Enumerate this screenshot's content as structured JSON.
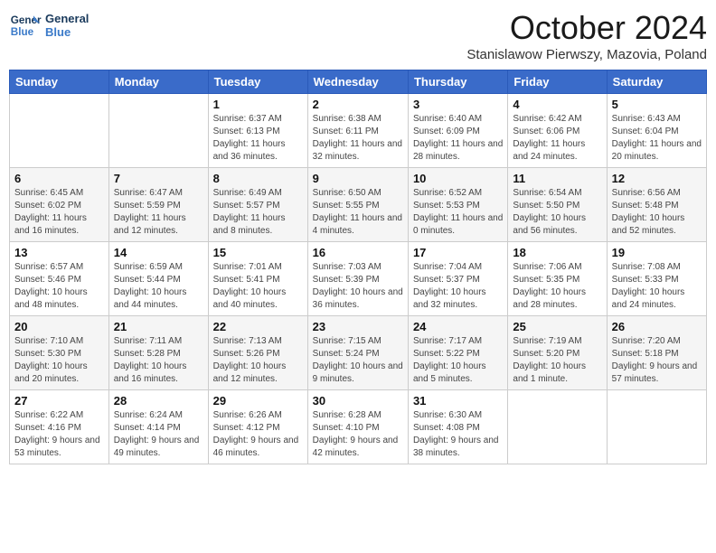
{
  "header": {
    "logo_line1": "General",
    "logo_line2": "Blue",
    "title": "October 2024",
    "subtitle": "Stanislawow Pierwszy, Mazovia, Poland"
  },
  "weekdays": [
    "Sunday",
    "Monday",
    "Tuesday",
    "Wednesday",
    "Thursday",
    "Friday",
    "Saturday"
  ],
  "weeks": [
    [
      {
        "day": "",
        "info": ""
      },
      {
        "day": "",
        "info": ""
      },
      {
        "day": "1",
        "info": "Sunrise: 6:37 AM\nSunset: 6:13 PM\nDaylight: 11 hours and 36 minutes."
      },
      {
        "day": "2",
        "info": "Sunrise: 6:38 AM\nSunset: 6:11 PM\nDaylight: 11 hours and 32 minutes."
      },
      {
        "day": "3",
        "info": "Sunrise: 6:40 AM\nSunset: 6:09 PM\nDaylight: 11 hours and 28 minutes."
      },
      {
        "day": "4",
        "info": "Sunrise: 6:42 AM\nSunset: 6:06 PM\nDaylight: 11 hours and 24 minutes."
      },
      {
        "day": "5",
        "info": "Sunrise: 6:43 AM\nSunset: 6:04 PM\nDaylight: 11 hours and 20 minutes."
      }
    ],
    [
      {
        "day": "6",
        "info": "Sunrise: 6:45 AM\nSunset: 6:02 PM\nDaylight: 11 hours and 16 minutes."
      },
      {
        "day": "7",
        "info": "Sunrise: 6:47 AM\nSunset: 5:59 PM\nDaylight: 11 hours and 12 minutes."
      },
      {
        "day": "8",
        "info": "Sunrise: 6:49 AM\nSunset: 5:57 PM\nDaylight: 11 hours and 8 minutes."
      },
      {
        "day": "9",
        "info": "Sunrise: 6:50 AM\nSunset: 5:55 PM\nDaylight: 11 hours and 4 minutes."
      },
      {
        "day": "10",
        "info": "Sunrise: 6:52 AM\nSunset: 5:53 PM\nDaylight: 11 hours and 0 minutes."
      },
      {
        "day": "11",
        "info": "Sunrise: 6:54 AM\nSunset: 5:50 PM\nDaylight: 10 hours and 56 minutes."
      },
      {
        "day": "12",
        "info": "Sunrise: 6:56 AM\nSunset: 5:48 PM\nDaylight: 10 hours and 52 minutes."
      }
    ],
    [
      {
        "day": "13",
        "info": "Sunrise: 6:57 AM\nSunset: 5:46 PM\nDaylight: 10 hours and 48 minutes."
      },
      {
        "day": "14",
        "info": "Sunrise: 6:59 AM\nSunset: 5:44 PM\nDaylight: 10 hours and 44 minutes."
      },
      {
        "day": "15",
        "info": "Sunrise: 7:01 AM\nSunset: 5:41 PM\nDaylight: 10 hours and 40 minutes."
      },
      {
        "day": "16",
        "info": "Sunrise: 7:03 AM\nSunset: 5:39 PM\nDaylight: 10 hours and 36 minutes."
      },
      {
        "day": "17",
        "info": "Sunrise: 7:04 AM\nSunset: 5:37 PM\nDaylight: 10 hours and 32 minutes."
      },
      {
        "day": "18",
        "info": "Sunrise: 7:06 AM\nSunset: 5:35 PM\nDaylight: 10 hours and 28 minutes."
      },
      {
        "day": "19",
        "info": "Sunrise: 7:08 AM\nSunset: 5:33 PM\nDaylight: 10 hours and 24 minutes."
      }
    ],
    [
      {
        "day": "20",
        "info": "Sunrise: 7:10 AM\nSunset: 5:30 PM\nDaylight: 10 hours and 20 minutes."
      },
      {
        "day": "21",
        "info": "Sunrise: 7:11 AM\nSunset: 5:28 PM\nDaylight: 10 hours and 16 minutes."
      },
      {
        "day": "22",
        "info": "Sunrise: 7:13 AM\nSunset: 5:26 PM\nDaylight: 10 hours and 12 minutes."
      },
      {
        "day": "23",
        "info": "Sunrise: 7:15 AM\nSunset: 5:24 PM\nDaylight: 10 hours and 9 minutes."
      },
      {
        "day": "24",
        "info": "Sunrise: 7:17 AM\nSunset: 5:22 PM\nDaylight: 10 hours and 5 minutes."
      },
      {
        "day": "25",
        "info": "Sunrise: 7:19 AM\nSunset: 5:20 PM\nDaylight: 10 hours and 1 minute."
      },
      {
        "day": "26",
        "info": "Sunrise: 7:20 AM\nSunset: 5:18 PM\nDaylight: 9 hours and 57 minutes."
      }
    ],
    [
      {
        "day": "27",
        "info": "Sunrise: 6:22 AM\nSunset: 4:16 PM\nDaylight: 9 hours and 53 minutes."
      },
      {
        "day": "28",
        "info": "Sunrise: 6:24 AM\nSunset: 4:14 PM\nDaylight: 9 hours and 49 minutes."
      },
      {
        "day": "29",
        "info": "Sunrise: 6:26 AM\nSunset: 4:12 PM\nDaylight: 9 hours and 46 minutes."
      },
      {
        "day": "30",
        "info": "Sunrise: 6:28 AM\nSunset: 4:10 PM\nDaylight: 9 hours and 42 minutes."
      },
      {
        "day": "31",
        "info": "Sunrise: 6:30 AM\nSunset: 4:08 PM\nDaylight: 9 hours and 38 minutes."
      },
      {
        "day": "",
        "info": ""
      },
      {
        "day": "",
        "info": ""
      }
    ]
  ]
}
